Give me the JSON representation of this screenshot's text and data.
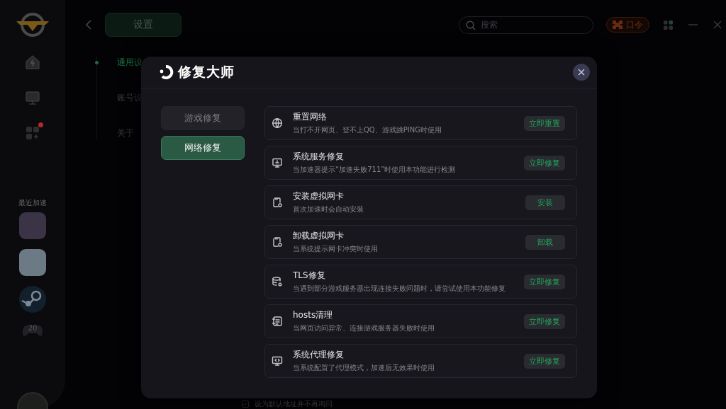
{
  "sidebar": {
    "items": [
      {
        "kind": "home",
        "badge": false
      },
      {
        "kind": "monitor",
        "badge": false
      },
      {
        "kind": "apps",
        "badge": true
      }
    ],
    "recent_label": "最近加速",
    "recent_games": [
      {
        "kind": "photo"
      },
      {
        "kind": "photo"
      },
      {
        "kind": "steam"
      }
    ],
    "controller_count": "20"
  },
  "top_bar": {
    "title": "设置",
    "search": {
      "placeholder": "搜索"
    },
    "code_button": "口令"
  },
  "settings_nav": [
    {
      "label": "通用设",
      "selected": true
    },
    {
      "label": "账号设",
      "selected": false
    },
    {
      "label": "关于",
      "selected": false
    }
  ],
  "background_option": {
    "label": "设为默认地址并不再询问"
  },
  "dialog": {
    "title": "修复大师",
    "tabs": [
      {
        "label": "游戏修复",
        "selected": false
      },
      {
        "label": "网络修复",
        "selected": true
      }
    ],
    "items": [
      {
        "kind": "globe",
        "title": "重置网络",
        "description": "当打不开网页、登不上QQ、游戏跳PING时使用",
        "action": "立即重置"
      },
      {
        "kind": "monitor",
        "title": "系统服务修复",
        "description": "当加速器提示“加速失败711”时使用本功能进行检测",
        "action": "立即修复"
      },
      {
        "kind": "card",
        "title": "安装虚拟网卡",
        "description": "首次加速时会自动安装",
        "action": "安装"
      },
      {
        "kind": "card",
        "title": "卸载虚拟网卡",
        "description": "当系统提示网卡冲突时使用",
        "action": "卸载"
      },
      {
        "kind": "database",
        "title": "TLS修复",
        "description": "当遇到部分游戏服务器出现连接失败问题时，请尝试使用本功能修复",
        "action": "立即修复"
      },
      {
        "kind": "list",
        "title": "hosts清理",
        "description": "当网页访问异常、连接游戏服务器失败时使用",
        "action": "立即修复"
      },
      {
        "kind": "screen",
        "title": "系统代理修复",
        "description": "当系统配置了代理模式，加速后无效果时使用",
        "action": "立即修复"
      }
    ]
  }
}
